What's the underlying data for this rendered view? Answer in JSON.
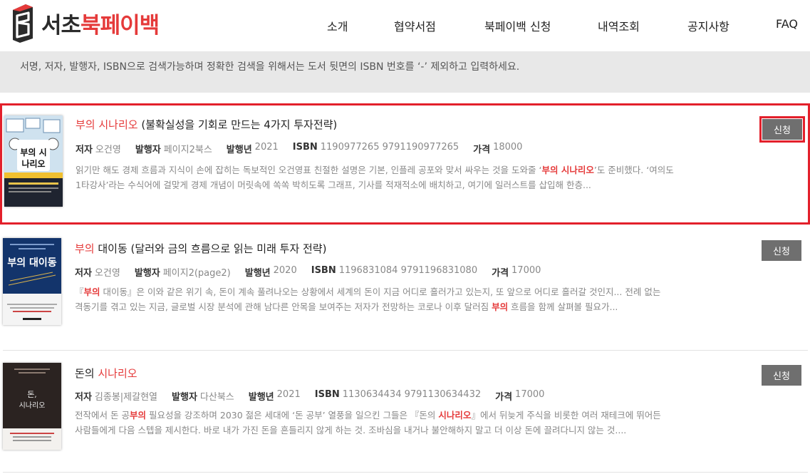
{
  "logo": {
    "name_prefix": "서초",
    "name_suffix": "북페이백",
    "colors": {
      "dark": "#2b2b2b",
      "accent": "#e53a3a"
    }
  },
  "nav": [
    {
      "label": "소개"
    },
    {
      "label": "협약서점"
    },
    {
      "label": "북페이백 신청"
    },
    {
      "label": "내역조회"
    },
    {
      "label": "공지사항"
    },
    {
      "label": "FAQ"
    }
  ],
  "search_hint": "서명, 저자, 발행자, ISBN으로 검색가능하며 정확한 검색을 위해서는 도서 뒷면의 ISBN 번호를 ‘-’ 제외하고 입력하세요.",
  "labels": {
    "author": "저자",
    "publisher": "발행자",
    "year": "발행년",
    "isbn": "ISBN",
    "price": "가격",
    "apply": "신청"
  },
  "books": [
    {
      "title_highlight": "부의 시나리오",
      "title_rest": " (불확실성을 기회로 만드는 4가지 투자전략)",
      "author": "오건영",
      "publisher": "페이지2북스",
      "year": "2021",
      "isbn": "1190977265 9791190977265",
      "price": "18000",
      "desc_1": "읽기만 해도 경제 흐름과 지식이 손에 잡히는 독보적인 오건영표 친절한 설명은 기본, 인플레 공포와 맞서 싸우는 것을 도와줄 ‘",
      "desc_hl": "부의 시나리오",
      "desc_2": "’도 준비했다. ‘여의도",
      "desc_line2": "1타강사’라는 수식어에 걸맞게 경제 개념이 머릿속에 쏙쏙 박히도록 그래프, 기사를 적재적소에 배치하고, 여기에 일러스트를 삽입해 한층...",
      "cover_text": "부의 시나리오",
      "selected": true
    },
    {
      "title_highlight": "부의",
      "title_rest": " 대이동 (달러와 금의 흐름으로 읽는 미래 투자 전략)",
      "author": "오건영",
      "publisher": "페이지2(page2)",
      "year": "2020",
      "isbn": "1196831084 9791196831080",
      "price": "17000",
      "desc_1": "『",
      "desc_hl": "부의",
      "desc_2": " 대이동』은 이와 같은 위기 속, 돈이 계속 풀려나오는 상황에서 세계의 돈이 지금 어디로 흘러가고 있는지, 또 앞으로 어디로 흘러갈 것인지... 전례 없는",
      "desc_line2_a": "격동기를 겪고 있는 지금, 글로벌 시장 분석에 관해 남다른 안목을 보여주는 저자가 전망하는 코로나 이후 달러짐 ",
      "desc_line2_hl": "부의",
      "desc_line2_b": " 흐름을 함께 살펴볼 필요가...",
      "cover_text": "부의 대이동",
      "selected": false
    },
    {
      "title_plain": "돈의 ",
      "title_highlight": "시나리오",
      "author": "김종봉|제갈현열",
      "publisher": "다산북스",
      "year": "2021",
      "isbn": "1130634434 9791130634432",
      "price": "17000",
      "desc_1a": "전작에서 돈 공",
      "desc_1hl": "부의",
      "desc_1b": " 필요성을 강조하며 2030 젊은 세대에 ‘돈 공부’ 열풍을 일으킨 그들은 『돈의 ",
      "desc_1hl2": "시나리오",
      "desc_1c": "』에서 뒤늦게 주식을 비롯한 여러 재테크에 뛰어든",
      "desc_line2": "사람들에게 다음 스텝을 제시한다. 바로 내가 가진 돈을 흔들리지 않게 하는 것. 조바심을 내거나 불안해하지 말고 더 이상 돈에 끌려다니지 않는 것....",
      "cover_text_1": "돈,",
      "cover_text_2": "시나리오",
      "selected": false
    }
  ]
}
